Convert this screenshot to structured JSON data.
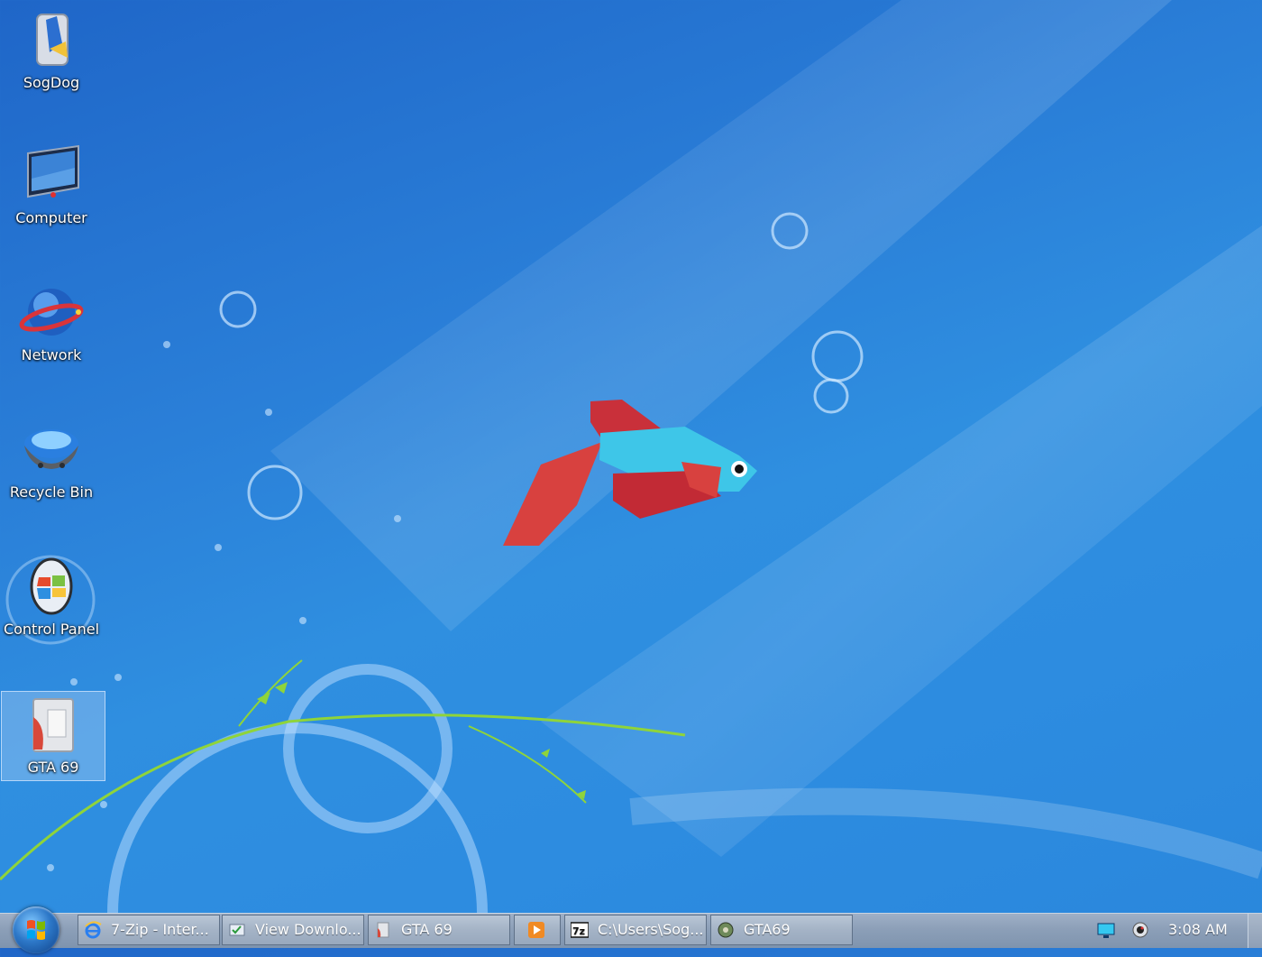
{
  "desktop": {
    "icons": [
      {
        "label": "SogDog",
        "icon": "user-folder-icon"
      },
      {
        "label": "Computer",
        "icon": "computer-icon"
      },
      {
        "label": "Network",
        "icon": "network-globe-icon"
      },
      {
        "label": "Recycle Bin",
        "icon": "recycle-bin-icon"
      },
      {
        "label": "Control Panel",
        "icon": "control-panel-icon"
      },
      {
        "label": "GTA 69",
        "icon": "folder-icon",
        "selected": true
      }
    ]
  },
  "taskbar": {
    "start_icon": "windows-start-orb",
    "buttons": [
      {
        "label": "7-Zip - Inter...",
        "icon": "internet-explorer-icon"
      },
      {
        "label": "View Downlo...",
        "icon": "downloads-icon"
      },
      {
        "label": "GTA 69",
        "icon": "folder-icon"
      },
      {
        "label": "",
        "icon": "media-player-icon"
      },
      {
        "label": "C:\\Users\\Sog...",
        "icon": "7zip-icon"
      },
      {
        "label": "GTA69",
        "icon": "game-icon"
      }
    ],
    "tray_icons": [
      "network-monitor-icon",
      "webcam-icon"
    ],
    "clock": "3:08 AM"
  },
  "colors": {
    "wallpaper": "#2a7fd8",
    "fish_body": "#3ec6e8",
    "fish_fins": "#d13a3a",
    "vine": "#8fd43a"
  }
}
